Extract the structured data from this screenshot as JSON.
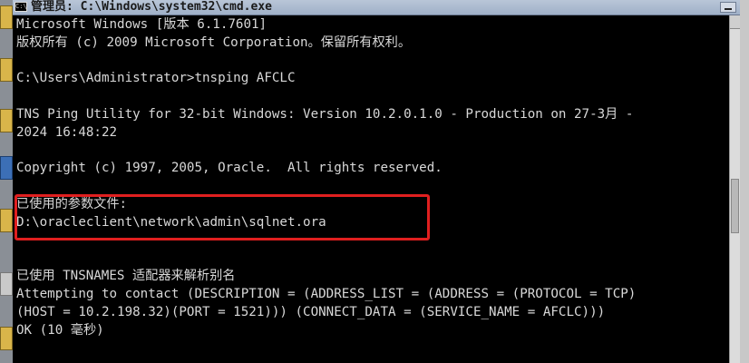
{
  "window": {
    "title": "管理员: C:\\Windows\\system32\\cmd.exe"
  },
  "console": {
    "lines": [
      "Microsoft Windows [版本 6.1.7601]",
      "版权所有 (c) 2009 Microsoft Corporation。保留所有权利。",
      "",
      "C:\\Users\\Administrator>tnsping AFCLC",
      "",
      "TNS Ping Utility for 32-bit Windows: Version 10.2.0.1.0 - Production on 27-3月 -",
      "2024 16:48:22",
      "",
      "Copyright (c) 1997, 2005, Oracle.  All rights reserved.",
      "",
      "已使用的参数文件:",
      "D:\\oracleclient\\network\\admin\\sqlnet.ora",
      "",
      "",
      "已使用 TNSNAMES 适配器来解析别名",
      "Attempting to contact (DESCRIPTION = (ADDRESS_LIST = (ADDRESS = (PROTOCOL = TCP)",
      "(HOST = 10.2.198.32)(PORT = 1521))) (CONNECT_DATA = (SERVICE_NAME = AFCLC)))",
      "OK (10 毫秒)",
      ""
    ]
  },
  "annotation": {
    "color": "#e01f1f"
  }
}
